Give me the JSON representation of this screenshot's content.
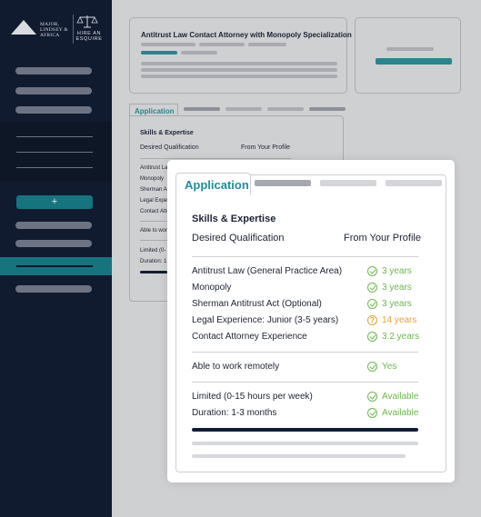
{
  "brand": {
    "firm_name": "MAJOR, LINDSEY & AFRICA",
    "tagline": "HIRE AN ESQUIRE"
  },
  "sidebar": {
    "add_label": "+"
  },
  "job": {
    "title": "Antitrust Law Contact Attorney with Monopoly Specialization"
  },
  "background_panel": {
    "tab_label": "Application",
    "section_title": "Skills & Expertise",
    "col_desired": "Desired Qualification",
    "col_profile": "From Your Profile",
    "row_fragments": [
      "Antitrust La",
      "Monopoly",
      "Sherman Ac",
      "Legal Expe",
      "Contact Atto",
      "Able to wor",
      "Limited (0-",
      "Duration: 1"
    ]
  },
  "modal": {
    "tab_label": "Application",
    "section_title": "Skills & Expertise",
    "col_desired": "Desired Qualification",
    "col_profile": "From Your Profile",
    "skills": [
      {
        "label": "Antitrust Law (General Practice Area)",
        "value": "3 years",
        "status": "ok"
      },
      {
        "label": "Monopoly",
        "value": "3 years",
        "status": "ok"
      },
      {
        "label": "Sherman Antitrust Act (Optional)",
        "value": "3 years",
        "status": "ok"
      },
      {
        "label": "Legal Experience: Junior (3-5 years)",
        "value": "14 years",
        "status": "warn"
      },
      {
        "label": "Contact Attorney Experience",
        "value": "3.2 years",
        "status": "ok"
      }
    ],
    "remote": {
      "label": "Able to work remotely",
      "value": "Yes",
      "status": "ok"
    },
    "availability": [
      {
        "label": "Limited (0-15 hours per week)",
        "value": "Available",
        "status": "ok"
      },
      {
        "label": "Duration: 1-3 months",
        "value": "Available",
        "status": "ok"
      }
    ],
    "question_glyph": "?"
  },
  "colors": {
    "teal": "#1e8f9b",
    "navy": "#101b30",
    "ok_green": "#6cb850",
    "warn_orange": "#e7a137"
  }
}
